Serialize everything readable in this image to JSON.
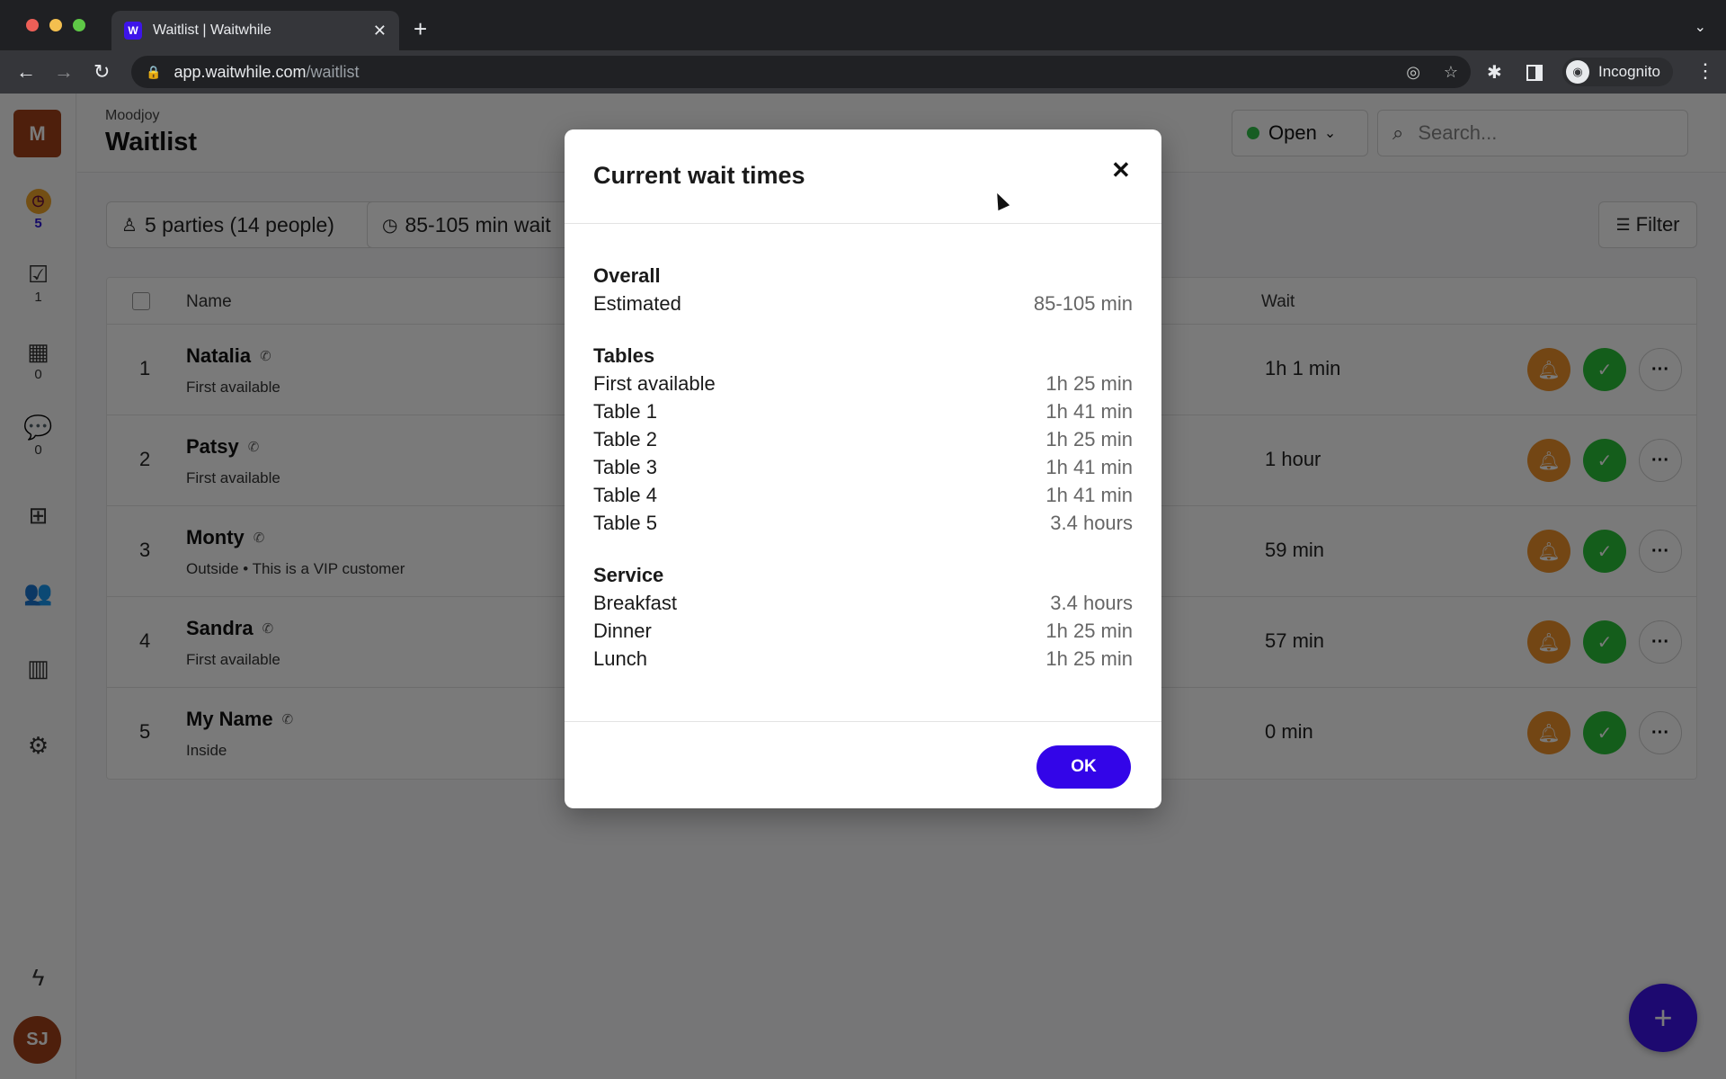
{
  "browser": {
    "tab_title": "Waitlist | Waitwhile",
    "favicon_letter": "W",
    "url_host": "app.waitwhile.com",
    "url_path": "/waitlist",
    "profile_label": "Incognito",
    "icons": {
      "back": "←",
      "forward": "→",
      "reload": "↻",
      "lock": "🔒",
      "eye_off": "◎",
      "star": "☆",
      "extensions": "✱",
      "close_tab": "✕",
      "new_tab": "+",
      "tab_menu": "⌄",
      "menu": "⋮",
      "incognito": "◉"
    }
  },
  "sidebar": {
    "org_initial": "M",
    "items": [
      {
        "name": "waitlist",
        "icon": "◷",
        "count": "5"
      },
      {
        "name": "serving",
        "icon": "☑",
        "count": "1"
      },
      {
        "name": "bookings",
        "icon": "▦",
        "count": "0"
      },
      {
        "name": "messages",
        "icon": "💬",
        "count": "0"
      },
      {
        "name": "apps",
        "icon": "⊞"
      },
      {
        "name": "customers",
        "icon": "👥"
      },
      {
        "name": "analytics",
        "icon": "▥"
      },
      {
        "name": "settings",
        "icon": "⚙"
      },
      {
        "name": "whats-new",
        "icon": "ϟ"
      }
    ],
    "user_initials": "SJ"
  },
  "header": {
    "org_name": "Moodjoy",
    "title": "Waitlist",
    "status": "Open",
    "status_color": "#31c24a",
    "search_placeholder": "Search..."
  },
  "toolbar": {
    "parties_label": "5 parties (14 people)",
    "wait_label": "85-105 min wait",
    "filter_label": "Filter"
  },
  "list": {
    "columns": {
      "name": "Name",
      "wait": "Wait"
    },
    "rows": [
      {
        "pos": "1",
        "name": "Natalia",
        "note": "First available",
        "wait": "1h 1 min"
      },
      {
        "pos": "2",
        "name": "Patsy",
        "note": "First available",
        "wait": "1 hour"
      },
      {
        "pos": "3",
        "name": "Monty",
        "note": "Outside  • This is a VIP customer",
        "wait": "59 min"
      },
      {
        "pos": "4",
        "name": "Sandra",
        "note": "First available",
        "wait": "57 min"
      },
      {
        "pos": "5",
        "name": "My Name",
        "note": "Inside",
        "wait": "0 min"
      }
    ]
  },
  "modal": {
    "title": "Current wait times",
    "close_icon": "✕",
    "sections": [
      {
        "title": "Overall",
        "rows": [
          {
            "label": "Estimated",
            "value": "85-105 min"
          }
        ]
      },
      {
        "title": "Tables",
        "rows": [
          {
            "label": "First available",
            "value": "1h 25 min"
          },
          {
            "label": "Table 1",
            "value": "1h 41 min"
          },
          {
            "label": "Table 2",
            "value": "1h 25 min"
          },
          {
            "label": "Table 3",
            "value": "1h 41 min"
          },
          {
            "label": "Table 4",
            "value": "1h 41 min"
          },
          {
            "label": "Table 5",
            "value": "3.4 hours"
          }
        ]
      },
      {
        "title": "Service",
        "rows": [
          {
            "label": "Breakfast",
            "value": "3.4 hours"
          },
          {
            "label": "Dinner",
            "value": "1h 25 min"
          },
          {
            "label": "Lunch",
            "value": "1h 25 min"
          }
        ]
      }
    ],
    "ok_label": "OK",
    "accent_color": "#3305e8"
  }
}
